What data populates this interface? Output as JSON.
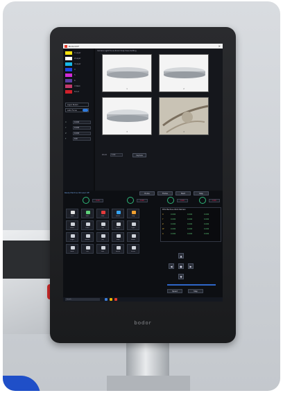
{
  "scene": {
    "brand": "bodor",
    "colors": {
      "accent": "#1f4fc8",
      "knob": "#d12a2a",
      "screen_bg": "#0c0d10"
    }
  },
  "app": {
    "title": "BodorCUT",
    "close_glyph": "×",
    "legend": [
      {
        "label": "1-Layer",
        "color": "#f5e20f"
      },
      {
        "label": "2-Layer",
        "color": "#ffffff"
      },
      {
        "label": "3-Layer",
        "color": "#17b8e8"
      },
      {
        "label": "4",
        "color": "#2146e0"
      },
      {
        "label": "5",
        "color": "#d02bd6"
      },
      {
        "label": "6",
        "color": "#5a3fa0"
      },
      {
        "label": "7-Mark",
        "color": "#c23a6a"
      },
      {
        "label": "8-Cut",
        "color": "#d0202a"
      }
    ],
    "side_buttons": [
      "Layer Param",
      "Auto Focus"
    ],
    "fields": [
      {
        "label": "X",
        "value": "0.000"
      },
      {
        "label": "Y",
        "value": "0.000"
      },
      {
        "label": "Z",
        "value": "0.000"
      },
      {
        "label": "F",
        "value": "100"
      }
    ],
    "camera_toolbar": "Camera  Light  Focus  Zoom  Snap  Save  Setting",
    "thumbnails": [
      {
        "caption": "1"
      },
      {
        "caption": "2"
      },
      {
        "caption": "3"
      },
      {
        "caption": "4"
      }
    ],
    "zoom": {
      "label": "Zoom",
      "value": "1.0x",
      "button": "Capture"
    }
  },
  "control": {
    "status": "Ready  Machine OK  Laser Off",
    "top_buttons": [
      "Home",
      "Frame",
      "Start",
      "Stop"
    ],
    "gauges": [
      "0.00",
      "0.00",
      "0.00",
      "0.00"
    ],
    "keys": [
      {
        "label": "Open",
        "color": "#e0e0e0"
      },
      {
        "label": "Save",
        "color": "#5fd07a"
      },
      {
        "label": "Start",
        "color": "#e33b3b"
      },
      {
        "label": "Pause",
        "color": "#36a3f0"
      },
      {
        "label": "Stop",
        "color": "#f0a030"
      },
      {
        "label": "Frame",
        "color": "#cfd3da"
      },
      {
        "label": "Laser",
        "color": "#cfd3da"
      },
      {
        "label": "Gas",
        "color": "#cfd3da"
      },
      {
        "label": "Focus",
        "color": "#cfd3da"
      },
      {
        "label": "Light",
        "color": "#cfd3da"
      },
      {
        "label": "Origin",
        "color": "#cfd3da"
      },
      {
        "label": "Return",
        "color": "#cfd3da"
      },
      {
        "label": "Jog",
        "color": "#cfd3da"
      },
      {
        "label": "Step",
        "color": "#cfd3da"
      },
      {
        "label": "Reset",
        "color": "#cfd3da"
      },
      {
        "label": "Blow",
        "color": "#cfd3da"
      },
      {
        "label": "Dot",
        "color": "#cfd3da"
      },
      {
        "label": "Path",
        "color": "#cfd3da"
      },
      {
        "label": "Break",
        "color": "#cfd3da"
      },
      {
        "label": "Pierce",
        "color": "#cfd3da"
      }
    ],
    "coords": {
      "header": "POS  Machine  Work  Remain",
      "rows": [
        {
          "axis": "X",
          "m": "0.000",
          "w": "0.000",
          "r": "0.000"
        },
        {
          "axis": "Y",
          "m": "0.000",
          "w": "0.000",
          "r": "0.000"
        },
        {
          "axis": "Z",
          "m": "0.000",
          "w": "0.000",
          "r": "0.000"
        },
        {
          "axis": "W",
          "m": "0.000",
          "w": "0.000",
          "r": "0.000"
        },
        {
          "axis": "A",
          "m": "0.000",
          "w": "0.000",
          "r": "0.000"
        }
      ]
    },
    "jog": {
      "up": "▲",
      "down": "▼",
      "left": "◀",
      "right": "▶",
      "center": "●"
    },
    "bottom_buttons": [
      "Speed",
      "Step"
    ],
    "taskbar_search": "Search"
  }
}
